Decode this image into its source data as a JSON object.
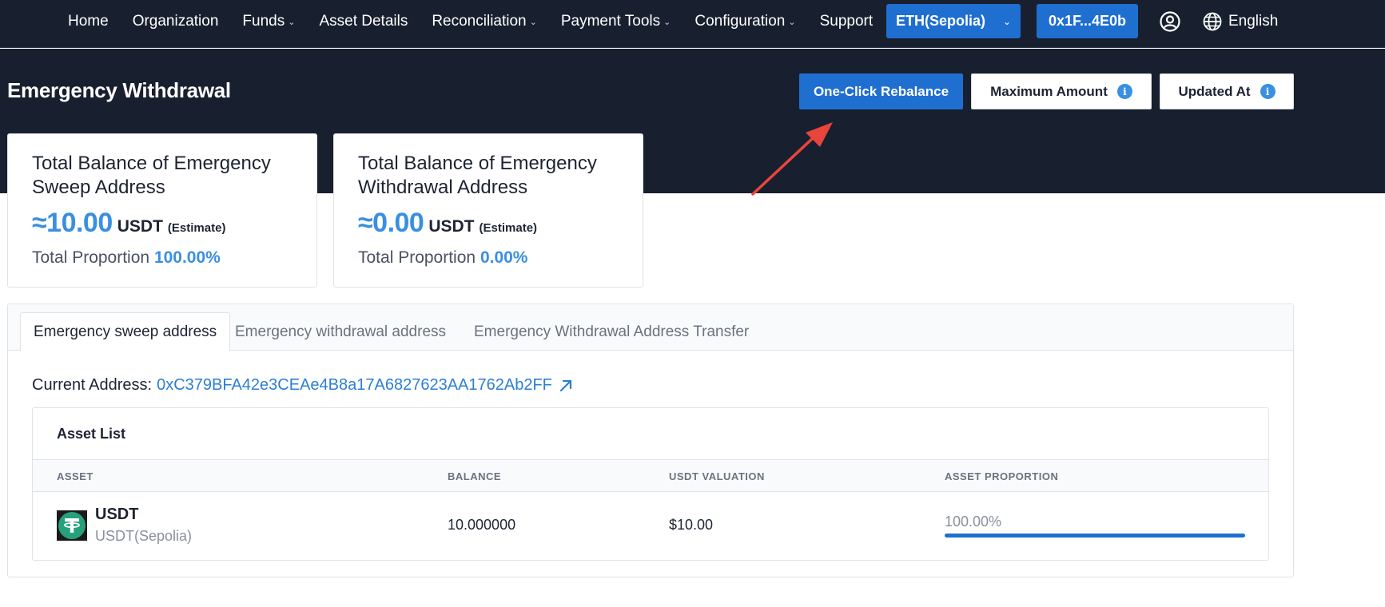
{
  "nav": {
    "items": [
      {
        "label": "Home",
        "dropdown": false
      },
      {
        "label": "Organization",
        "dropdown": false
      },
      {
        "label": "Funds",
        "dropdown": true
      },
      {
        "label": "Asset Details",
        "dropdown": false
      },
      {
        "label": "Reconciliation",
        "dropdown": true
      },
      {
        "label": "Payment Tools",
        "dropdown": true
      },
      {
        "label": "Configuration",
        "dropdown": true
      },
      {
        "label": "Support",
        "dropdown": false
      }
    ],
    "network": "ETH(Sepolia)",
    "wallet": "0x1F...4E0b",
    "language": "English"
  },
  "header": {
    "title": "Emergency Withdrawal",
    "rebalance_label": "One-Click Rebalance",
    "max_amount_label": "Maximum Amount",
    "updated_at_label": "Updated At"
  },
  "cards": [
    {
      "title": "Total Balance of Emergency Sweep Address",
      "value": "≈10.00",
      "unit": "USDT",
      "estimate": "(Estimate)",
      "proportion_label": "Total Proportion",
      "proportion": "100.00%"
    },
    {
      "title": "Total Balance of Emergency Withdrawal Address",
      "value": "≈0.00",
      "unit": "USDT",
      "estimate": "(Estimate)",
      "proportion_label": "Total Proportion",
      "proportion": "0.00%"
    }
  ],
  "tabs": [
    {
      "label": "Emergency sweep address",
      "active": true
    },
    {
      "label": "Emergency withdrawal address",
      "active": false
    },
    {
      "label": "Emergency Withdrawal Address Transfer",
      "active": false
    }
  ],
  "current_address": {
    "label": "Current Address:",
    "value": "0xC379BFA42e3CEAe4B8a17A6827623AA1762Ab2FF"
  },
  "asset_list": {
    "title": "Asset List",
    "columns": [
      "ASSET",
      "BALANCE",
      "USDT VALUATION",
      "ASSET PROPORTION"
    ],
    "rows": [
      {
        "asset": "USDT",
        "network": "USDT(Sepolia)",
        "balance": "10.000000",
        "valuation": "$10.00",
        "proportion": "100.00%",
        "proportion_value": 100
      }
    ]
  },
  "colors": {
    "header_bg": "#18202f",
    "primary": "#1f6fd1",
    "accent_text": "#3a8fe0",
    "link": "#2b7fd6",
    "tether_green": "#26a17b",
    "annotation_arrow": "#e8453c"
  },
  "icons": {
    "user": "user-circle-icon",
    "language": "globe-icon",
    "info": "info-icon",
    "external_link": "external-link-icon",
    "coin": "tether-icon"
  }
}
